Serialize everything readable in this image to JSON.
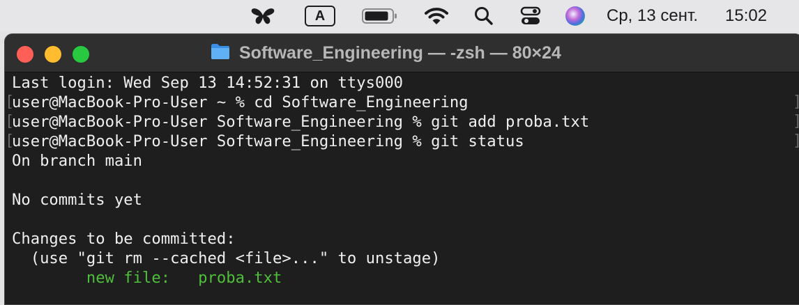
{
  "menubar": {
    "icons": [
      "butterfly-icon",
      "input-source-icon",
      "battery-icon",
      "wifi-icon",
      "search-icon",
      "control-center-icon",
      "siri-icon"
    ],
    "input_source_label": "A",
    "date": "Ср, 13 сент.",
    "time": "15:02"
  },
  "window": {
    "title": "Software_Engineering — -zsh — 80×24",
    "title_icon": "folder-icon",
    "colors": {
      "close": "#ff5f57",
      "minimize": "#febc2e",
      "zoom": "#28c840",
      "background": "#1e1e1e",
      "staged_file": "#4fbf3a"
    }
  },
  "terminal": {
    "last_login": "Last login: Wed Sep 13 14:52:31 on ttys000",
    "commands": [
      "user@MacBook-Pro-User ~ % cd Software_Engineering",
      "user@MacBook-Pro-User Software_Engineering % git add proba.txt",
      "user@MacBook-Pro-User Software_Engineering % git status"
    ],
    "output": {
      "branch": "On branch main",
      "commits": "No commits yet",
      "changes_header": "Changes to be committed:",
      "hint": "  (use \"git rm --cached <file>...\" to unstage)",
      "staged_prefix": "        new file:   ",
      "staged_file": "proba.txt"
    },
    "bracket_left": "[",
    "bracket_right": "]"
  }
}
